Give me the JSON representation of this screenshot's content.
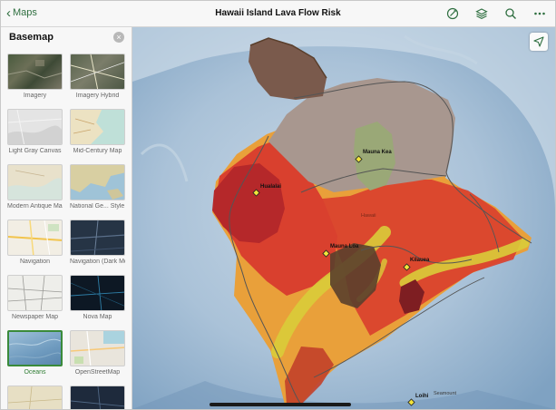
{
  "topbar": {
    "back_label": "Maps",
    "title": "Hawaii Island Lava Flow Risk",
    "icons": [
      "sketch-icon",
      "layers-icon",
      "search-icon",
      "more-icon"
    ]
  },
  "sidebar": {
    "title": "Basemap",
    "selected": "Oceans",
    "tiles": [
      {
        "label": "Imagery"
      },
      {
        "label": "Imagery Hybrid"
      },
      {
        "label": "Light Gray Canvas"
      },
      {
        "label": "Mid-Century Map"
      },
      {
        "label": "Modern Antique Map"
      },
      {
        "label": "National Ge... Style Map"
      },
      {
        "label": "Navigation"
      },
      {
        "label": "Navigation (Dark Mode)"
      },
      {
        "label": "Newspaper Map"
      },
      {
        "label": "Nova Map"
      },
      {
        "label": "Oceans"
      },
      {
        "label": "OpenStreetMap"
      },
      {
        "label": ""
      },
      {
        "label": ""
      }
    ]
  },
  "map": {
    "labels": {
      "mauna_kea": "Mauna Kea",
      "hualalai": "Hualalai",
      "mauna_loa": "Mauna Loa",
      "kilauea": "Kilauea",
      "loihi": "Loihi",
      "seamount": "Seamount",
      "hawaii": "Hawaii"
    },
    "colors": {
      "ocean": "#a9c2d8",
      "zone_dark_red": "#b5282a",
      "zone_red": "#d9402e",
      "zone_orange": "#e07a2a",
      "zone_light_orange": "#e9a03a",
      "zone_yellow": "#d9cc3a",
      "zone_brown": "#5a3f2c",
      "zone_gray": "#a8978f",
      "zone_green": "#9aa877"
    }
  }
}
